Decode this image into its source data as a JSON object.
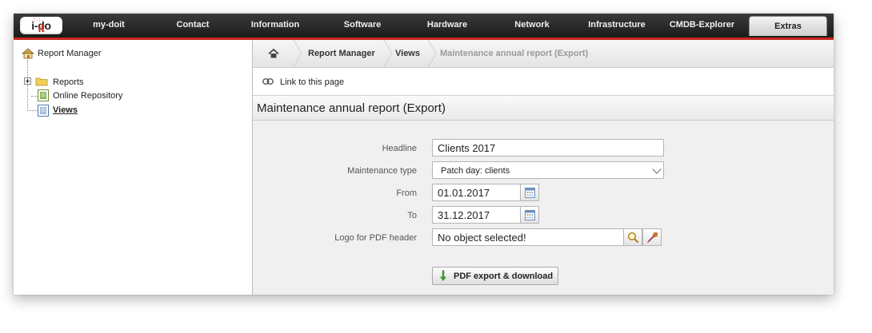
{
  "nav": {
    "logo_text": "i-doit",
    "items": [
      "my-doit",
      "Contact",
      "Information",
      "Software",
      "Hardware",
      "Network",
      "Infrastructure",
      "CMDB-Explorer"
    ],
    "active_item": "Extras"
  },
  "tree": {
    "root": "Report Manager",
    "items": [
      "Reports",
      "Online Repository",
      "Views"
    ],
    "selected": "Views"
  },
  "breadcrumb": {
    "items": [
      "Report Manager",
      "Views",
      "Maintenance annual report (Export)"
    ]
  },
  "link_label": "Link to this page",
  "page_title": "Maintenance annual report (Export)",
  "form": {
    "headline": {
      "label": "Headline",
      "value": "Clients 2017"
    },
    "maintenance_type": {
      "label": "Maintenance type",
      "value": "Patch day: clients"
    },
    "from": {
      "label": "From",
      "value": "01.01.2017"
    },
    "to": {
      "label": "To",
      "value": "31.12.2017"
    },
    "logo": {
      "label": "Logo for PDF header",
      "value": "No object selected!"
    }
  },
  "export_button": "PDF export & download",
  "colors": {
    "accent": "#c8281e",
    "nav_bg": "#1c1c1c",
    "panel_bg": "#f0f0f0"
  },
  "icons": [
    "home-icon",
    "link-icon",
    "calendar-icon",
    "search-icon",
    "detach-icon",
    "arrow-down-icon",
    "folder-icon",
    "report-manager-icon"
  ]
}
